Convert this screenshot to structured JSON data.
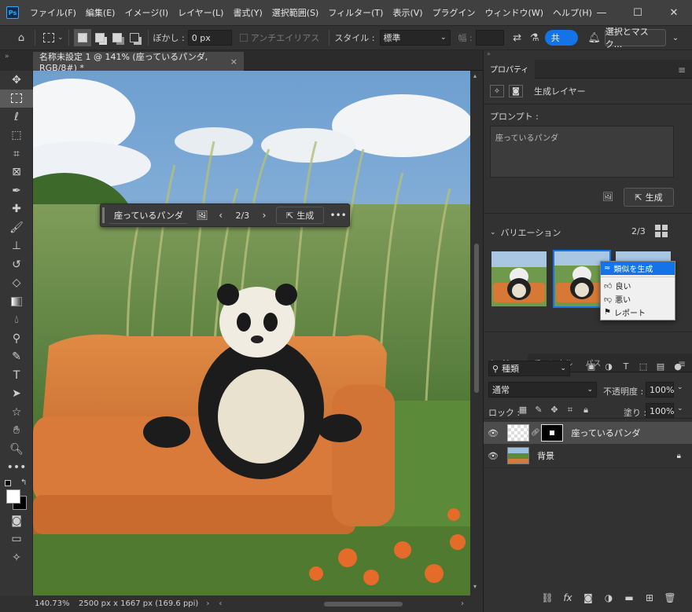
{
  "app": {
    "logo": "Ps",
    "menus": [
      "ファイル(F)",
      "編集(E)",
      "イメージ(I)",
      "レイヤー(L)",
      "書式(Y)",
      "選択範囲(S)",
      "フィルター(T)",
      "表示(V)",
      "プラグイン",
      "ウィンドウ(W)",
      "ヘルプ(H)"
    ]
  },
  "options": {
    "feather_label": "ぼかし :",
    "feather_value": "0 px",
    "antialias_label": "アンチエイリアス",
    "style_label": "スタイル :",
    "style_value": "標準",
    "width_label": "幅 :",
    "select_mask_label": "選択とマスク...",
    "share_label": "共"
  },
  "document": {
    "tab_title": "名称未設定 1 @ 141% (座っているパンダ, RGB/8#) *",
    "tab_close": "×"
  },
  "status": {
    "zoom": "140.73%",
    "info": "2500 px x 1667 px (169.6 ppi)"
  },
  "ctxbar": {
    "prompt": "座っているパンダ",
    "counter": "2/3",
    "generate_label": "生成"
  },
  "properties": {
    "tab": "プロパティ",
    "layer_type": "生成レイヤー",
    "prompt_label": "プロンプト :",
    "prompt_text": "座っているパンダ",
    "generate_label": "生成",
    "variations_label": "バリエーション",
    "variations_count": "2/3"
  },
  "popup": {
    "similar": "類似を生成",
    "good": "良い",
    "bad": "悪い",
    "report": "レポート"
  },
  "layers": {
    "tabs": [
      "レイヤー",
      "チャンネル",
      "パス"
    ],
    "filter_value": "種類",
    "blend_mode": "通常",
    "opacity_label": "不透明度 :",
    "opacity_value": "100%",
    "lock_label": "ロック :",
    "fill_label": "塗り :",
    "fill_value": "100%",
    "items": [
      {
        "name": "座っているパンダ"
      },
      {
        "name": "背景"
      }
    ]
  }
}
